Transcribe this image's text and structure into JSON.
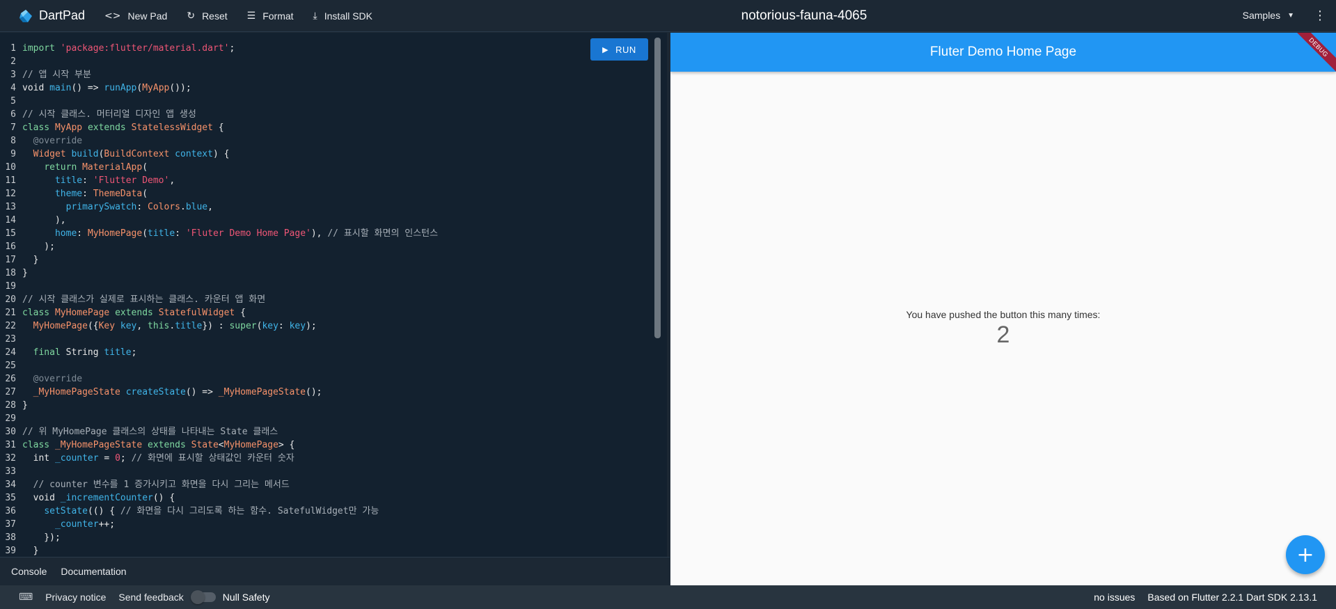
{
  "topbar": {
    "app_name": "DartPad",
    "new_pad": "New Pad",
    "reset": "Reset",
    "format": "Format",
    "install_sdk": "Install SDK",
    "pad_title": "notorious-fauna-4065",
    "samples": "Samples"
  },
  "editor": {
    "run_label": "RUN",
    "lines": [
      [
        [
          "kw",
          "import "
        ],
        [
          "str",
          "'package:flutter/material.dart'"
        ],
        [
          "plain",
          ";"
        ]
      ],
      [],
      [
        [
          "cm",
          "// 앱 시작 부분"
        ]
      ],
      [
        [
          "plain",
          "void "
        ],
        [
          "fn",
          "main"
        ],
        [
          "plain",
          "() => "
        ],
        [
          "fn",
          "runApp"
        ],
        [
          "plain",
          "("
        ],
        [
          "type",
          "MyApp"
        ],
        [
          "plain",
          "());"
        ]
      ],
      [],
      [
        [
          "cm",
          "// 시작 클래스. 머터리얼 디자인 앱 생성"
        ]
      ],
      [
        [
          "kw",
          "class "
        ],
        [
          "type",
          "MyApp "
        ],
        [
          "kw",
          "extends "
        ],
        [
          "type",
          "StatelessWidget "
        ],
        [
          "plain",
          "{"
        ]
      ],
      [
        [
          "plain",
          "  "
        ],
        [
          "ann",
          "@override"
        ]
      ],
      [
        [
          "plain",
          "  "
        ],
        [
          "type",
          "Widget "
        ],
        [
          "fn",
          "build"
        ],
        [
          "plain",
          "("
        ],
        [
          "type",
          "BuildContext "
        ],
        [
          "fn",
          "context"
        ],
        [
          "plain",
          ") {"
        ]
      ],
      [
        [
          "plain",
          "    "
        ],
        [
          "kw",
          "return "
        ],
        [
          "type",
          "MaterialApp"
        ],
        [
          "plain",
          "("
        ]
      ],
      [
        [
          "plain",
          "      "
        ],
        [
          "fn",
          "title"
        ],
        [
          "plain",
          ": "
        ],
        [
          "str",
          "'Flutter Demo'"
        ],
        [
          "plain",
          ","
        ]
      ],
      [
        [
          "plain",
          "      "
        ],
        [
          "fn",
          "theme"
        ],
        [
          "plain",
          ": "
        ],
        [
          "type",
          "ThemeData"
        ],
        [
          "plain",
          "("
        ]
      ],
      [
        [
          "plain",
          "        "
        ],
        [
          "fn",
          "primarySwatch"
        ],
        [
          "plain",
          ": "
        ],
        [
          "type",
          "Colors"
        ],
        [
          "plain",
          "."
        ],
        [
          "fn",
          "blue"
        ],
        [
          "plain",
          ","
        ]
      ],
      [
        [
          "plain",
          "      ),"
        ]
      ],
      [
        [
          "plain",
          "      "
        ],
        [
          "fn",
          "home"
        ],
        [
          "plain",
          ": "
        ],
        [
          "type",
          "MyHomePage"
        ],
        [
          "plain",
          "("
        ],
        [
          "fn",
          "title"
        ],
        [
          "plain",
          ": "
        ],
        [
          "str",
          "'Fluter Demo Home Page'"
        ],
        [
          "plain",
          "), "
        ],
        [
          "cm",
          "// 표시할 화면의 인스턴스"
        ]
      ],
      [
        [
          "plain",
          "    );"
        ]
      ],
      [
        [
          "plain",
          "  }"
        ]
      ],
      [
        [
          "plain",
          "}"
        ]
      ],
      [],
      [
        [
          "cm",
          "// 시작 클래스가 실제로 표시하는 클래스. 카운터 앱 화면"
        ]
      ],
      [
        [
          "kw",
          "class "
        ],
        [
          "type",
          "MyHomePage "
        ],
        [
          "kw",
          "extends "
        ],
        [
          "type",
          "StatefulWidget "
        ],
        [
          "plain",
          "{"
        ]
      ],
      [
        [
          "plain",
          "  "
        ],
        [
          "type",
          "MyHomePage"
        ],
        [
          "plain",
          "({"
        ],
        [
          "type",
          "Key "
        ],
        [
          "fn",
          "key"
        ],
        [
          "plain",
          ", "
        ],
        [
          "kw",
          "this"
        ],
        [
          "plain",
          "."
        ],
        [
          "fn",
          "title"
        ],
        [
          "plain",
          "}) : "
        ],
        [
          "kw",
          "super"
        ],
        [
          "plain",
          "("
        ],
        [
          "fn",
          "key"
        ],
        [
          "plain",
          ": "
        ],
        [
          "fn",
          "key"
        ],
        [
          "plain",
          ");"
        ]
      ],
      [],
      [
        [
          "plain",
          "  "
        ],
        [
          "kw",
          "final "
        ],
        [
          "plain",
          "String "
        ],
        [
          "fn",
          "title"
        ],
        [
          "plain",
          ";"
        ]
      ],
      [],
      [
        [
          "plain",
          "  "
        ],
        [
          "ann",
          "@override"
        ]
      ],
      [
        [
          "plain",
          "  "
        ],
        [
          "type",
          "_MyHomePageState "
        ],
        [
          "fn",
          "createState"
        ],
        [
          "plain",
          "() => "
        ],
        [
          "type",
          "_MyHomePageState"
        ],
        [
          "plain",
          "();"
        ]
      ],
      [
        [
          "plain",
          "}"
        ]
      ],
      [],
      [
        [
          "cm",
          "// 위 MyHomePage 클래스의 상태를 나타내는 State 클래스"
        ]
      ],
      [
        [
          "kw",
          "class "
        ],
        [
          "type",
          "_MyHomePageState "
        ],
        [
          "kw",
          "extends "
        ],
        [
          "type",
          "State"
        ],
        [
          "plain",
          "<"
        ],
        [
          "type",
          "MyHomePage"
        ],
        [
          "plain",
          "> {"
        ]
      ],
      [
        [
          "plain",
          "  int "
        ],
        [
          "fn",
          "_counter"
        ],
        [
          "plain",
          " = "
        ],
        [
          "num",
          "0"
        ],
        [
          "plain",
          "; "
        ],
        [
          "cm",
          "// 화면에 표시할 상태값인 카운터 숫자"
        ]
      ],
      [],
      [
        [
          "plain",
          "  "
        ],
        [
          "cm",
          "// counter 변수를 1 증가시키고 화면을 다시 그리는 메서드"
        ]
      ],
      [
        [
          "plain",
          "  void "
        ],
        [
          "fn",
          "_incrementCounter"
        ],
        [
          "plain",
          "() {"
        ]
      ],
      [
        [
          "plain",
          "    "
        ],
        [
          "fn",
          "setState"
        ],
        [
          "plain",
          "(() { "
        ],
        [
          "cm",
          "// 화면을 다시 그리도록 하는 함수. SatefulWidget만 가능"
        ]
      ],
      [
        [
          "plain",
          "      "
        ],
        [
          "fn",
          "_counter"
        ],
        [
          "plain",
          "++;"
        ]
      ],
      [
        [
          "plain",
          "    });"
        ]
      ],
      [
        [
          "plain",
          "  }"
        ]
      ]
    ]
  },
  "bottom_tabs": {
    "console": "Console",
    "documentation": "Documentation"
  },
  "preview": {
    "appbar_title": "Fluter Demo Home Page",
    "debug_banner": "DEBUG",
    "message": "You have pushed the button this many times:",
    "counter": "2",
    "fab_icon": "add-icon"
  },
  "statusbar": {
    "privacy": "Privacy notice",
    "feedback": "Send feedback",
    "null_safety": "Null Safety",
    "null_safety_enabled": false,
    "issues": "no issues",
    "sdk_info": "Based on Flutter 2.2.1 Dart SDK 2.13.1"
  }
}
